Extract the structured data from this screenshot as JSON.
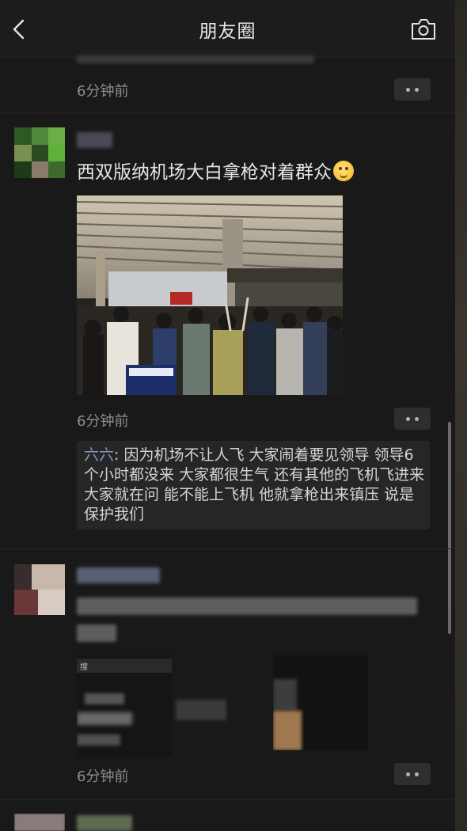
{
  "header": {
    "title": "朋友圈",
    "back_icon": "chevron-left-icon",
    "camera_icon": "camera-icon"
  },
  "feed": {
    "top_post": {
      "time": "6分钟前"
    },
    "main_post": {
      "text": "西双版纳机场大白拿枪对着群众",
      "emoji": "smiling-face-emoji",
      "time": "6分钟前",
      "comment": {
        "author": "六六",
        "separator": ": ",
        "text": "因为机场不让人飞 大家闹着要见领导 领导6个小时都没来 大家都很生气 还有其他的飞机飞进来 大家就在问 能不能上飞机 他就拿枪出来镇压 说是保护我们"
      }
    },
    "third_post": {
      "time": "6分钟前",
      "mini_search_text": "搜"
    }
  },
  "colors": {
    "background": "#191919",
    "comment_bg": "#262626",
    "comment_author": "#8795b7",
    "muted_text": "#8d8d8d"
  }
}
